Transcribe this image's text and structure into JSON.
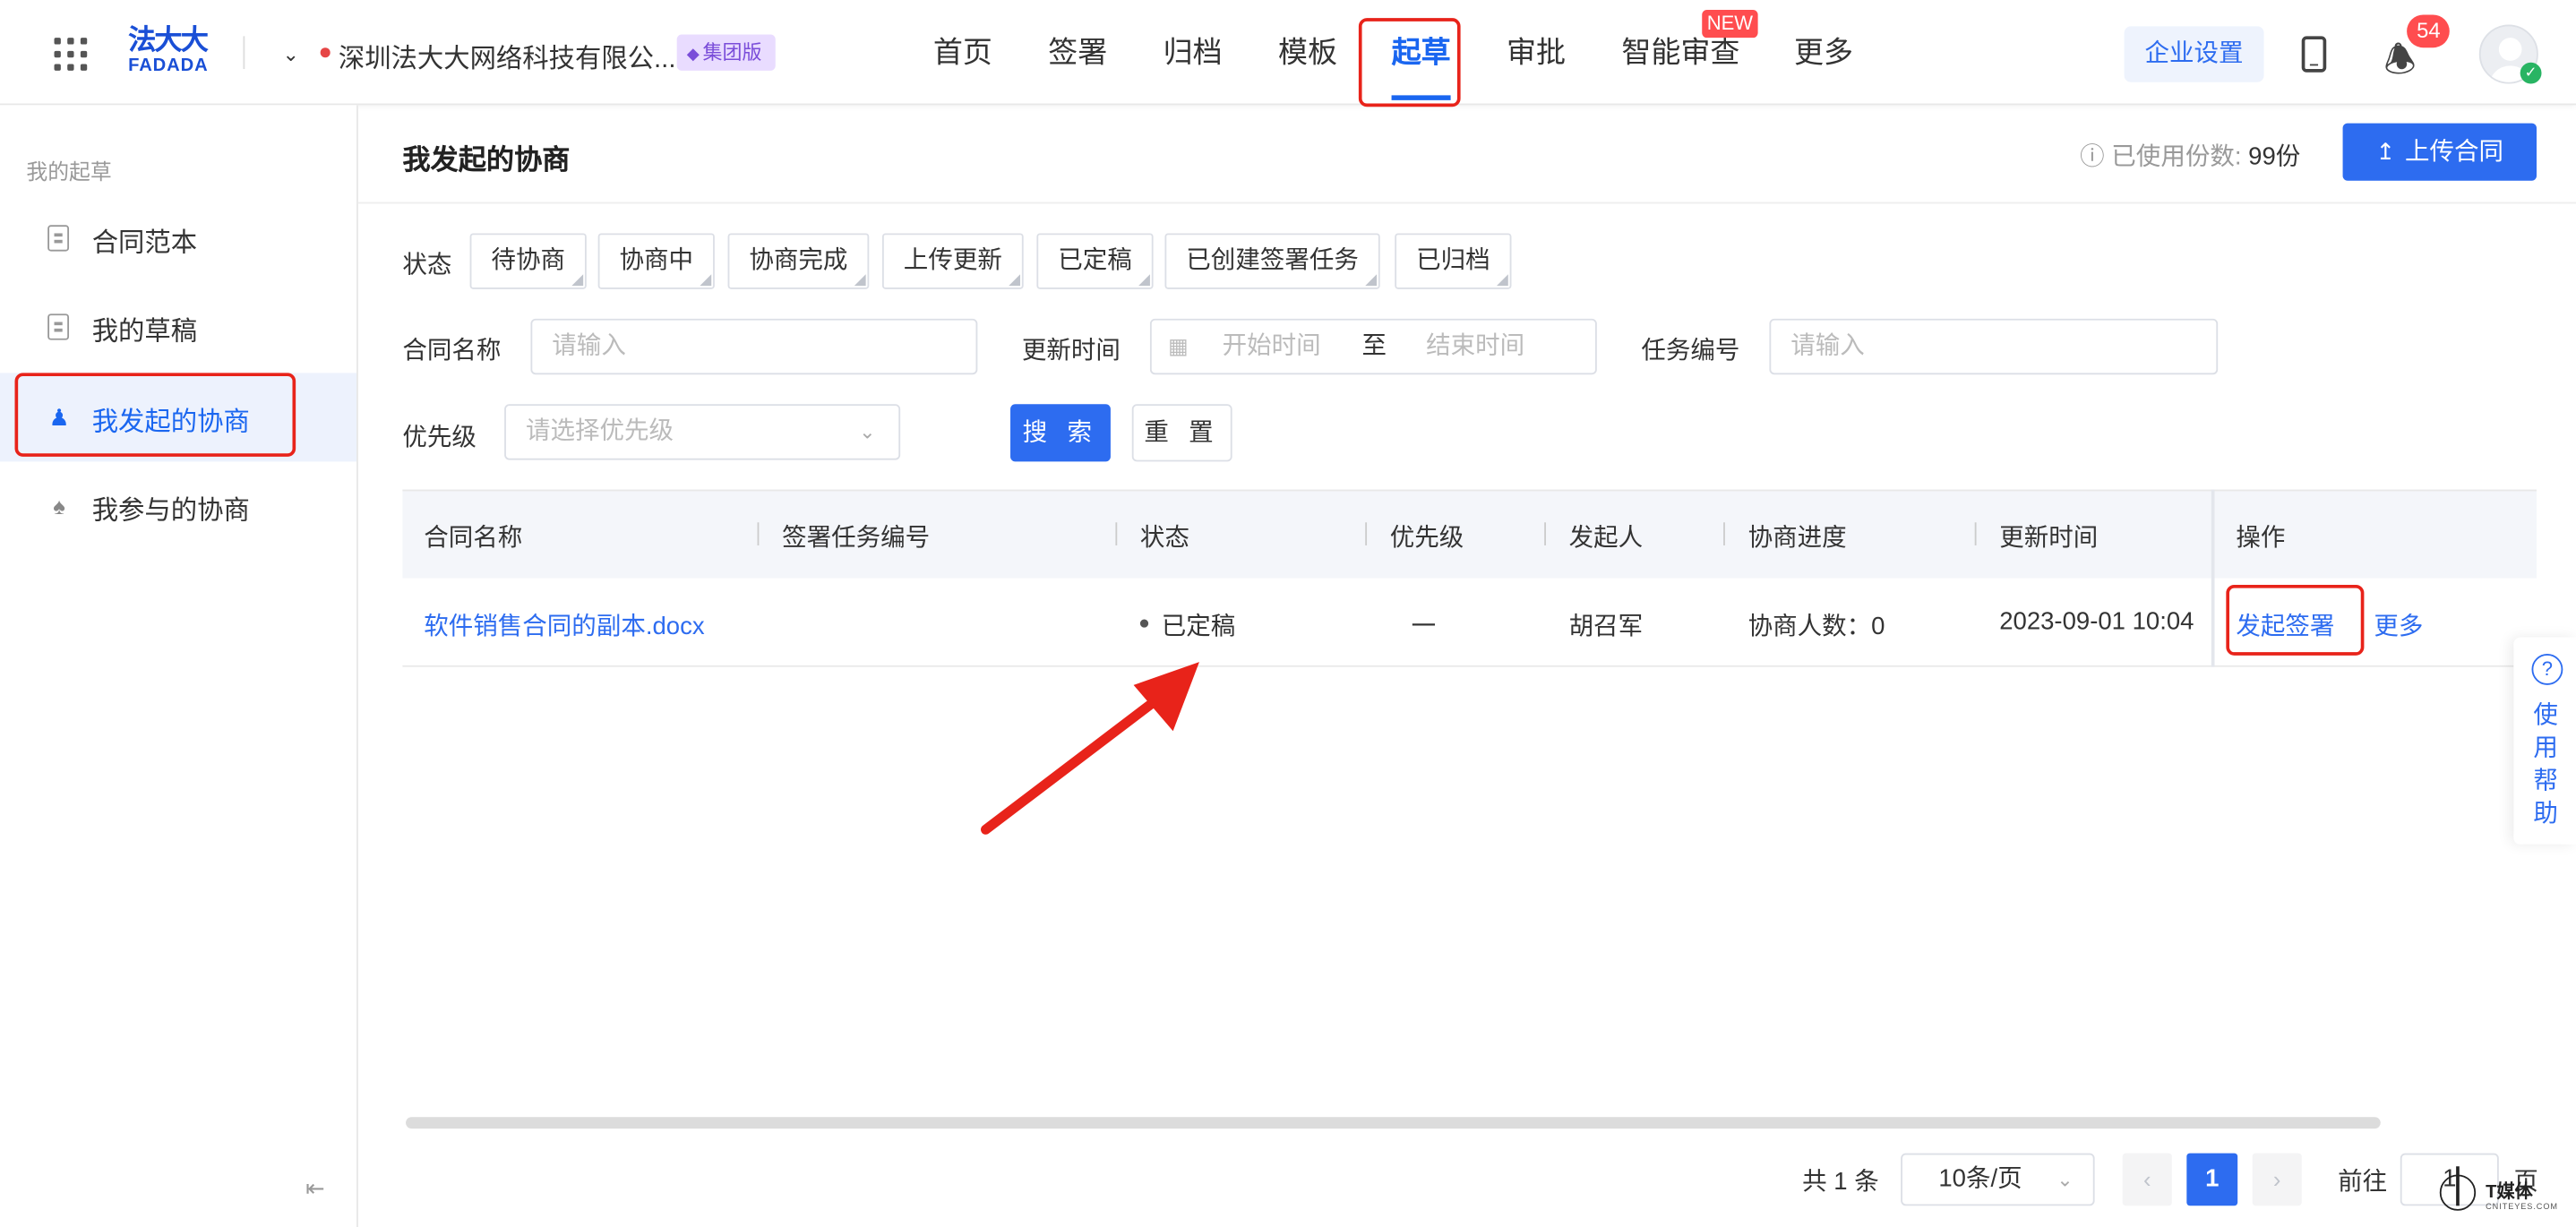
{
  "header": {
    "logo": {
      "line1": "法大大",
      "line2": "FADADA"
    },
    "company_name": "深圳法大大网络科技有限公...",
    "edition_badge": "集团版",
    "nav": [
      {
        "label": "首页"
      },
      {
        "label": "签署"
      },
      {
        "label": "归档"
      },
      {
        "label": "模板"
      },
      {
        "label": "起草",
        "active": true
      },
      {
        "label": "审批"
      },
      {
        "label": "智能审查",
        "badge": "NEW"
      },
      {
        "label": "更多"
      }
    ],
    "enterprise_settings": "企业设置",
    "notification_count": "54"
  },
  "sidebar": {
    "group_title": "我的起草",
    "items": [
      {
        "label": "合同范本",
        "icon": "document-list-icon"
      },
      {
        "label": "我的草稿",
        "icon": "document-icon"
      },
      {
        "label": "我发起的协商",
        "icon": "users-icon",
        "active": true
      },
      {
        "label": "我参与的协商",
        "icon": "user-list-icon"
      }
    ]
  },
  "main": {
    "title": "我发起的协商",
    "usage_label": "已使用份数:",
    "usage_value": "99份",
    "upload_button": "上传合同",
    "filters": {
      "status_label": "状态",
      "status_chips": [
        "待协商",
        "协商中",
        "协商完成",
        "上传更新",
        "已定稿",
        "已创建签署任务",
        "已归档"
      ],
      "contract_name_label": "合同名称",
      "contract_name_placeholder": "请输入",
      "update_time_label": "更新时间",
      "start_placeholder": "开始时间",
      "range_separator": "至",
      "end_placeholder": "结束时间",
      "task_no_label": "任务编号",
      "task_no_placeholder": "请输入",
      "priority_label": "优先级",
      "priority_placeholder": "请选择优先级",
      "search_button": "搜 索",
      "reset_button": "重 置"
    },
    "table": {
      "columns": [
        "合同名称",
        "签署任务编号",
        "状态",
        "优先级",
        "发起人",
        "协商进度",
        "更新时间",
        "操作"
      ],
      "rows": [
        {
          "contract_name": "软件销售合同的副本.docx",
          "task_no": "",
          "status": "已定稿",
          "priority": "一",
          "initiator": "胡召军",
          "progress": "协商人数：0",
          "updated_at": "2023-09-01 10:04",
          "actions": [
            "发起签署",
            "更多"
          ]
        }
      ]
    },
    "pagination": {
      "total": "共 1 条",
      "page_size": "10条/页",
      "current_page": "1",
      "goto_label": "前往",
      "goto_value": "1",
      "page_suffix": "页"
    }
  },
  "help": {
    "label": "使用帮助"
  },
  "watermark": {
    "text": "T媒体",
    "sub": "CNITEYES.COM"
  },
  "colors": {
    "accent": "#2d6cf0",
    "annotation": "#e8231a",
    "badge": "#ff4d4f"
  }
}
